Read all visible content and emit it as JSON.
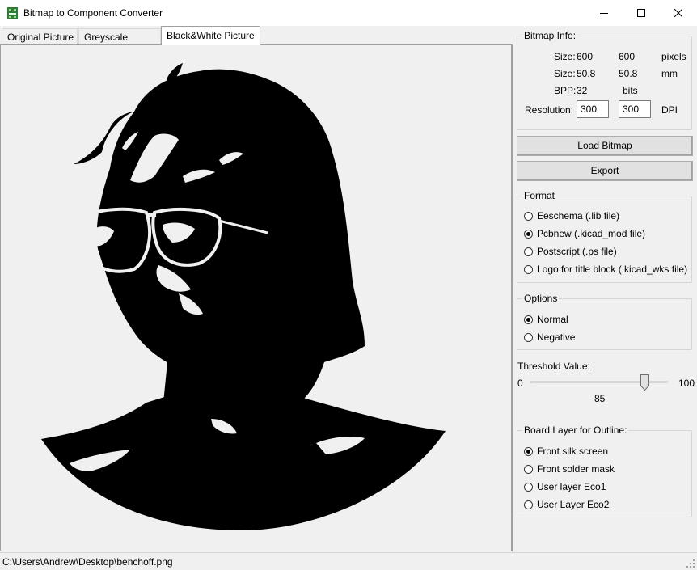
{
  "window": {
    "title": "Bitmap to Component Converter",
    "app_icon": "kicad-bitmap-icon",
    "controls": [
      "minimize-icon",
      "maximize-icon",
      "close-icon"
    ]
  },
  "tabs": [
    {
      "label": "Original Picture",
      "active": false
    },
    {
      "label": "Greyscale Picture",
      "active": false
    },
    {
      "label": "Black&White Picture",
      "active": true
    }
  ],
  "bitmap_info": {
    "title": "Bitmap Info:",
    "size_label": "Size:",
    "size_px": [
      "600",
      "600"
    ],
    "size_px_unit": "pixels",
    "size_mm": [
      "50.8",
      "50.8"
    ],
    "size_mm_unit": "mm",
    "bpp_label": "BPP:",
    "bpp": "32",
    "bpp_unit": "bits",
    "resolution_label": "Resolution:",
    "resolution": [
      "300",
      "300"
    ],
    "resolution_unit": "DPI"
  },
  "buttons": {
    "load": "Load Bitmap",
    "export": "Export"
  },
  "format": {
    "title": "Format",
    "options": [
      {
        "label": "Eeschema (.lib file)",
        "selected": false
      },
      {
        "label": "Pcbnew (.kicad_mod file)",
        "selected": true
      },
      {
        "label": "Postscript (.ps file)",
        "selected": false
      },
      {
        "label": "Logo for title block (.kicad_wks file)",
        "selected": false
      }
    ]
  },
  "options": {
    "title": "Options",
    "items": [
      {
        "label": "Normal",
        "selected": true
      },
      {
        "label": "Negative",
        "selected": false
      }
    ]
  },
  "threshold": {
    "label": "Threshold Value:",
    "min": "0",
    "max": "100",
    "value": "85"
  },
  "board_layer": {
    "title": "Board Layer for Outline:",
    "options": [
      {
        "label": "Front silk screen",
        "selected": true
      },
      {
        "label": "Front solder mask",
        "selected": false
      },
      {
        "label": "User layer Eco1",
        "selected": false
      },
      {
        "label": "User Layer Eco2",
        "selected": false
      }
    ]
  },
  "status": {
    "path": "C:\\Users\\Andrew\\Desktop\\benchoff.png"
  },
  "colors": {
    "window_bg": "#f0f0f0",
    "ink": "#000000",
    "button_face": "#e1e1e1"
  }
}
